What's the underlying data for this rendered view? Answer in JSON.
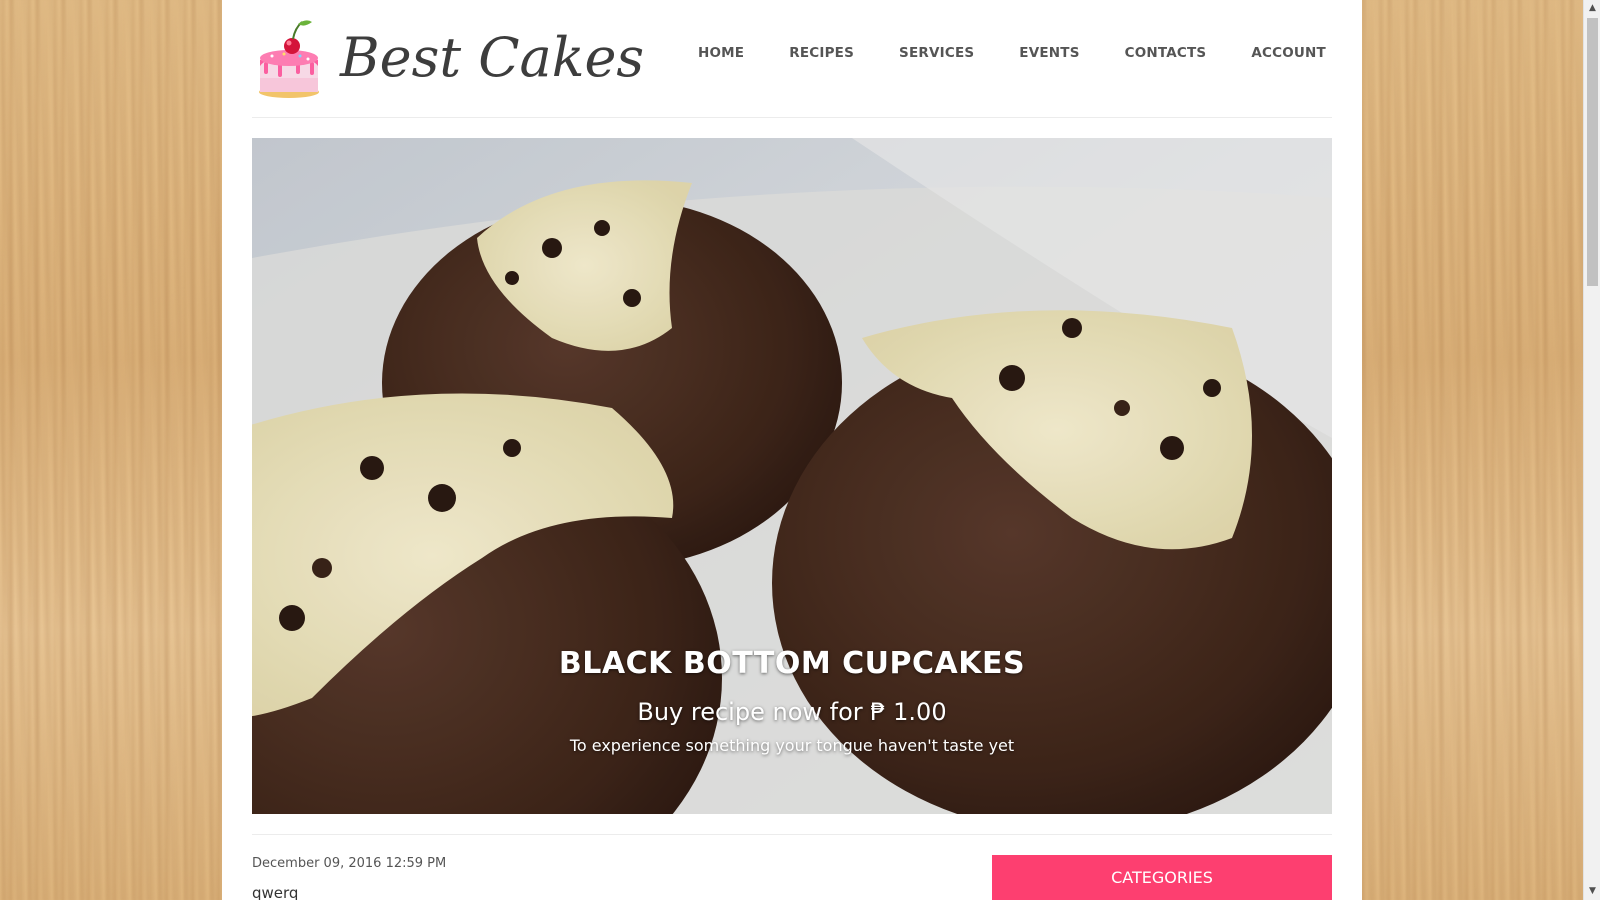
{
  "brand": {
    "name": "Best Cakes",
    "logo_icon": "cake-cherry-icon"
  },
  "nav": {
    "items": [
      {
        "label": "HOME"
      },
      {
        "label": "RECIPES"
      },
      {
        "label": "SERVICES"
      },
      {
        "label": "EVENTS"
      },
      {
        "label": "CONTACTS"
      },
      {
        "label": "ACCOUNT"
      }
    ]
  },
  "hero": {
    "title": "BLACK BOTTOM CUPCAKES",
    "price_line": "Buy recipe now for ₱ 1.00",
    "subtitle": "To experience something your tongue haven't taste yet",
    "image_subject": "black-bottom-cupcakes-photo"
  },
  "post": {
    "date": "December 09, 2016 12:59 PM",
    "title": "qwerq"
  },
  "sidebar": {
    "categories_label": "CATEGORIES"
  },
  "colors": {
    "accent": "#fd3f70",
    "nav_text": "#555555",
    "page_bg": "#ffffff",
    "wood": "#dcb27a"
  },
  "scrollbar": {
    "up_arrow": "▲",
    "down_arrow": "▼"
  }
}
